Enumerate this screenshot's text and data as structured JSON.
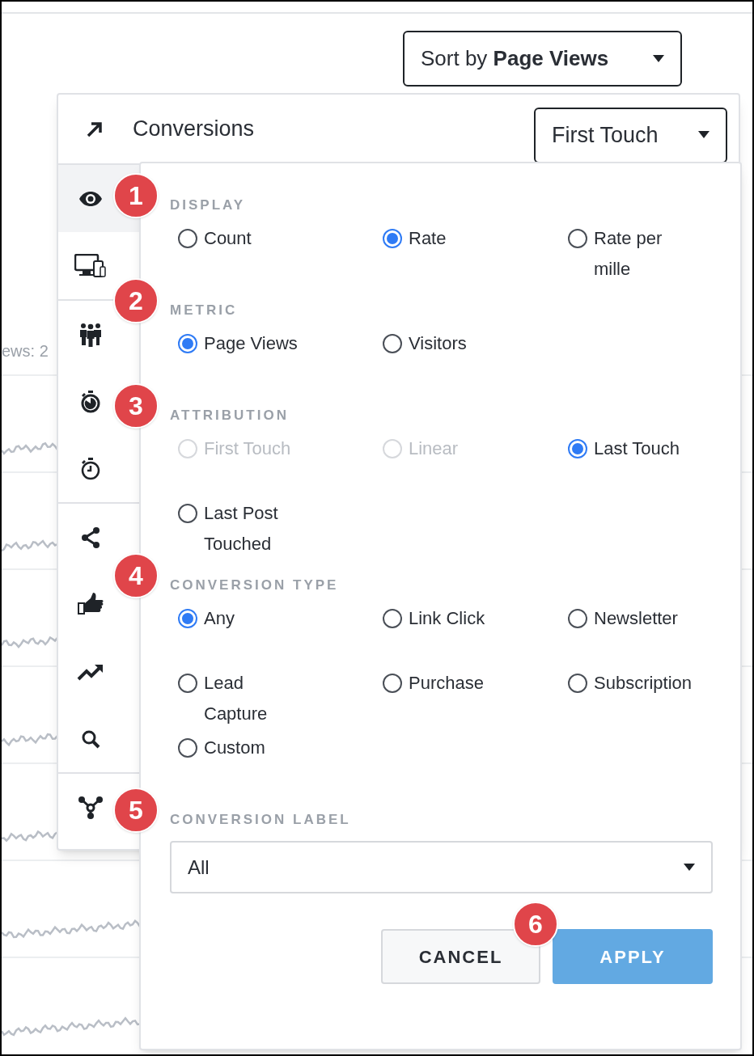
{
  "sort": {
    "label": "Sort by",
    "value": "Page Views"
  },
  "background": {
    "label": "ews: 2"
  },
  "menu": {
    "title": "Conversions",
    "attribution": "First Touch",
    "groups": [
      [
        {
          "kind": "eye",
          "selected": true
        },
        {
          "kind": "devices",
          "selected": false
        }
      ],
      [
        {
          "kind": "people",
          "selected": false
        },
        {
          "kind": "timer",
          "selected": false
        },
        {
          "kind": "stopwatch",
          "selected": false
        }
      ],
      [
        {
          "kind": "share",
          "selected": false
        },
        {
          "kind": "thumbs-up",
          "selected": false
        },
        {
          "kind": "trend",
          "selected": false
        },
        {
          "kind": "search",
          "selected": false
        }
      ],
      [
        {
          "kind": "network",
          "selected": false
        }
      ]
    ]
  },
  "popup": {
    "sections": [
      {
        "kind": "radios",
        "badge": "1",
        "heading": "DISPLAY",
        "options": [
          {
            "label": "Count",
            "selected": false,
            "disabled": false
          },
          {
            "label": "Rate",
            "selected": true,
            "disabled": false
          },
          {
            "label": "Rate per mille",
            "selected": false,
            "disabled": false
          }
        ]
      },
      {
        "kind": "radios",
        "badge": "2",
        "heading": "METRIC",
        "options": [
          {
            "label": "Page Views",
            "selected": true,
            "disabled": false
          },
          {
            "label": "Visitors",
            "selected": false,
            "disabled": false
          }
        ]
      },
      {
        "kind": "radios",
        "badge": "3",
        "heading": "ATTRIBUTION",
        "options": [
          {
            "label": "First Touch",
            "selected": false,
            "disabled": true
          },
          {
            "label": "Linear",
            "selected": false,
            "disabled": true
          },
          {
            "label": "Last Touch",
            "selected": true,
            "disabled": false
          },
          {
            "label": "Last Post Touched",
            "selected": false,
            "disabled": false
          }
        ]
      },
      {
        "kind": "radios",
        "badge": "4",
        "heading": "CONVERSION TYPE",
        "options": [
          {
            "label": "Any",
            "selected": true,
            "disabled": false
          },
          {
            "label": "Link Click",
            "selected": false,
            "disabled": false
          },
          {
            "label": "Newsletter",
            "selected": false,
            "disabled": false
          },
          {
            "label": "Lead Capture",
            "selected": false,
            "disabled": false
          },
          {
            "label": "Purchase",
            "selected": false,
            "disabled": false
          },
          {
            "label": "Subscription",
            "selected": false,
            "disabled": false
          },
          {
            "label": "Custom",
            "selected": false,
            "disabled": false
          }
        ]
      },
      {
        "kind": "select",
        "badge": "5",
        "heading": "CONVERSION LABEL",
        "value": "All"
      }
    ],
    "badge": "6",
    "cancel": "CANCEL",
    "apply": "APPLY"
  }
}
